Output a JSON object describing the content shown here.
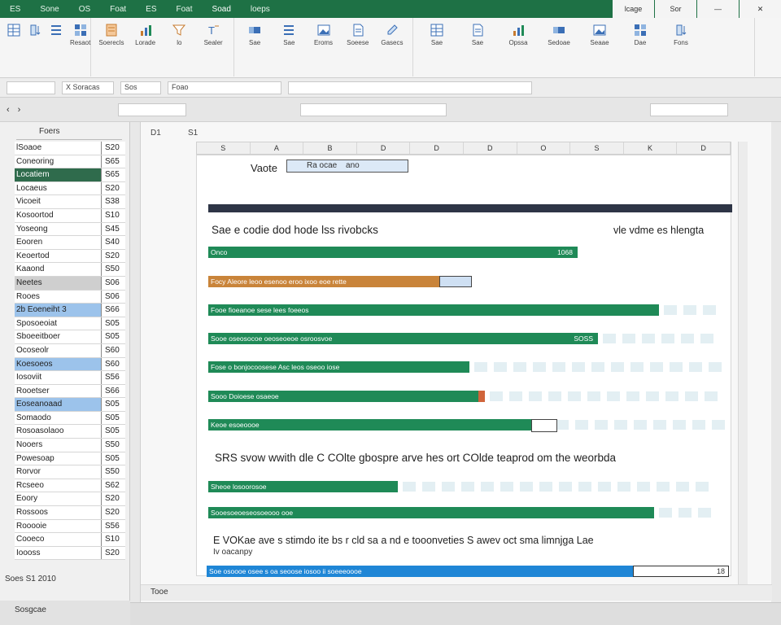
{
  "titlebar": {
    "tabs": [
      "ES",
      "Sone",
      "OS",
      "Foat",
      "ES",
      "Foat",
      "Soad",
      "loeps"
    ],
    "right": [
      "lcage",
      "Sor"
    ]
  },
  "ribbon": {
    "groups": [
      {
        "buttons": [
          {
            "label": "",
            "icon": "table-icon"
          },
          {
            "label": "",
            "icon": "sort-icon"
          },
          {
            "label": "",
            "icon": "list-icon"
          },
          {
            "label": "Resaot",
            "icon": "grid-icon"
          }
        ]
      },
      {
        "buttons": [
          {
            "label": "Soerecls",
            "icon": "sheet-icon"
          },
          {
            "label": "Lorade",
            "icon": "chart-icon"
          },
          {
            "label": "lo",
            "icon": "filter-icon"
          },
          {
            "label": "Sealer",
            "icon": "text-icon"
          }
        ]
      },
      {
        "buttons": [
          {
            "label": "Sae",
            "icon": "bar-icon"
          },
          {
            "label": "Sae",
            "icon": "list-icon"
          },
          {
            "label": "Eroms",
            "icon": "image-icon"
          },
          {
            "label": "Soeese",
            "icon": "doc-icon"
          },
          {
            "label": "Gasecs",
            "icon": "edit-icon"
          }
        ]
      },
      {
        "buttons": [
          {
            "label": "Sae",
            "icon": "table-icon"
          },
          {
            "label": "Sae",
            "icon": "doc-icon"
          },
          {
            "label": "Opssa",
            "icon": "chart-icon"
          },
          {
            "label": "Sedoae",
            "icon": "bar-icon"
          },
          {
            "label": "Seaae",
            "icon": "image-icon"
          },
          {
            "label": "Dae",
            "icon": "grid-icon"
          },
          {
            "label": "Fons",
            "icon": "sort-icon"
          }
        ]
      }
    ]
  },
  "formula_bar": {
    "name_box": "X Soracas",
    "fx": "Sos",
    "formula": "Foao"
  },
  "left_pane": {
    "header": "Foers",
    "rows": [
      {
        "name": "lSoaoe",
        "value": "S20"
      },
      {
        "name": "Coneoring",
        "value": "S65"
      },
      {
        "name": "Locatiem",
        "value": "S65",
        "sel": "green"
      },
      {
        "name": "Locaeus",
        "value": "S20"
      },
      {
        "name": "Vicoeit",
        "value": "S38"
      },
      {
        "name": "Kosoortod",
        "value": "S10"
      },
      {
        "name": "Yoseong",
        "value": "S45"
      },
      {
        "name": "Eooren",
        "value": "S40"
      },
      {
        "name": "Keoertod",
        "value": "S20"
      },
      {
        "name": "Kaaond",
        "value": "S50"
      },
      {
        "name": "Neetes",
        "value": "S06",
        "sel": "gray"
      },
      {
        "name": "Rooes",
        "value": "S06"
      },
      {
        "name": "2b Eoeneiht 3",
        "value": "S66",
        "sel": "blue"
      },
      {
        "name": "Sposoeoiat",
        "value": "S05"
      },
      {
        "name": "Sboeeitboer",
        "value": "S05"
      },
      {
        "name": "Ocoseolr",
        "value": "S60"
      },
      {
        "name": "Koesoeos",
        "value": "S60",
        "sel": "blue"
      },
      {
        "name": "Iosoviit",
        "value": "S56"
      },
      {
        "name": "Rooetser",
        "value": "S66"
      },
      {
        "name": "Eoseanoaad",
        "value": "S05",
        "sel": "blue"
      },
      {
        "name": "Somaodo",
        "value": "S05"
      },
      {
        "name": "Rosoasolaoo",
        "value": "S05"
      },
      {
        "name": "Nooers",
        "value": "S50"
      },
      {
        "name": "Powesoap",
        "value": "S05"
      },
      {
        "name": "Rorvor",
        "value": "S50"
      },
      {
        "name": "Rcseeo",
        "value": "S62"
      },
      {
        "name": "Eoory",
        "value": "S20"
      },
      {
        "name": "Rossoos",
        "value": "S20"
      },
      {
        "name": "Rooooie",
        "value": "S56"
      },
      {
        "name": "Cooeco",
        "value": "S10"
      },
      {
        "name": "Ioooss",
        "value": "S20"
      }
    ],
    "footer": "Soes S1 2010",
    "footer2": "Sosgcae"
  },
  "sheet": {
    "head_left": "D1",
    "head_right": "S1",
    "columns": [
      "S",
      "A",
      "B",
      "D",
      "D",
      "D",
      "O",
      "S",
      "K",
      "D"
    ],
    "name_label": "Vaote",
    "name_value": "Ra ocae",
    "name_value2": "ano",
    "section1_title": "Sae e codie dod hode lss rivobcks",
    "section1_right": "vle vdme es hlengta",
    "section2_title": "SRS svow wwith dle C COlte gbospre arve hes ort COlde teaprod om the weorbda",
    "section3_title": "E VOKae ave s stimdo ite bs r cld sa a nd e tooonveties S awev oct sma limnjga Lae",
    "section3_sub": "Iv oacanpy",
    "bars": [
      {
        "label": "Onco",
        "value": "1068",
        "color": "#1f8a57",
        "fill": 0.72,
        "ghost": false
      },
      {
        "label": "Focy Aleore leoo esenoo eroo ixoo eoe rette",
        "value": "",
        "color": "#c9843a",
        "fill": 0.45,
        "ghost": false,
        "box": true
      },
      {
        "label": "Fooe fioeanoe sese lees foeeos",
        "value": "",
        "color": "#1f8a57",
        "fill": 0.88,
        "ghost": true
      },
      {
        "label": "Sooe oseosocoe oeoseoeoe osroosvoe",
        "value": "SOSS",
        "color": "#1f8a57",
        "fill": 0.76,
        "ghost": true
      },
      {
        "label": "Fose o bonjocoosese Asc leos oseoo iose",
        "value": "",
        "color": "#1f8a57",
        "fill": 0.51,
        "ghost": true
      },
      {
        "label": "Sooo Doioese osaeoe",
        "value": "",
        "color": "#1f8a57",
        "fill": 0.54,
        "ghost": true,
        "accent": true
      },
      {
        "label": "Keoe esoeoooe",
        "value": "",
        "color": "#1f8a57",
        "fill": 0.63,
        "ghost": true,
        "endbox": true
      },
      {
        "label": "Sheoe losoorosoe",
        "value": "",
        "color": "#1f8a57",
        "fill": 0.37,
        "ghost": true
      },
      {
        "label": "Sooesoeoeseosoeooo ooe",
        "value": "",
        "color": "#1f8a57",
        "fill": 0.87,
        "ghost": true
      }
    ],
    "blue_bar_label": "Soe osoooe osee s oa seoose iosoo ii soeeeoooe",
    "blue_end_value": "18",
    "hscroll": "Tooe"
  },
  "colors": {
    "brand": "#1e7145",
    "green_bar": "#1f8a57",
    "orange_bar": "#c9843a",
    "blue_bar": "#1f86d6"
  }
}
